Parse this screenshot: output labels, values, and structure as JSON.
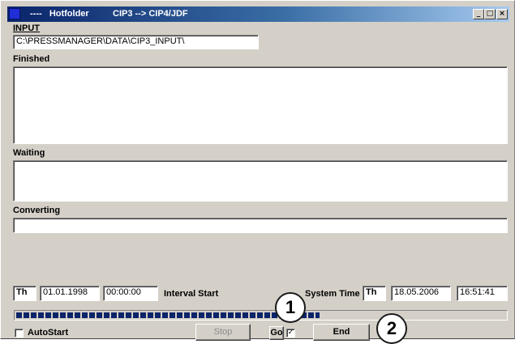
{
  "window": {
    "title_prefix": "----   Hotfolder",
    "title_text": "CIP3 --> CIP4/JDF",
    "min_glyph": "_",
    "max_glyph": "□",
    "close_glyph": "×",
    "title_gradient_start": "#0a246a"
  },
  "input": {
    "label": "INPUT",
    "path": "C:\\PRESSMANAGER\\DATA\\CIP3_INPUT\\"
  },
  "sections": {
    "finished_label": "Finished",
    "waiting_label": "Waiting",
    "converting_label": "Converting"
  },
  "interval": {
    "day": "Th",
    "date": "01.01.1998",
    "time": "00:00:00",
    "label": "Interval Start"
  },
  "system_time": {
    "label": "System Time",
    "day": "Th",
    "date": "18.05.2006",
    "time": "16:51:41"
  },
  "progress": {
    "fraction": 0.62
  },
  "controls": {
    "autostart_label": "AutoStart",
    "autostart_checked": false,
    "stop_label": "Stop",
    "go_label": "Go",
    "go_checked": true,
    "check_glyph": "✓",
    "end_label": "End"
  },
  "callouts": {
    "one": "1",
    "two": "2"
  }
}
